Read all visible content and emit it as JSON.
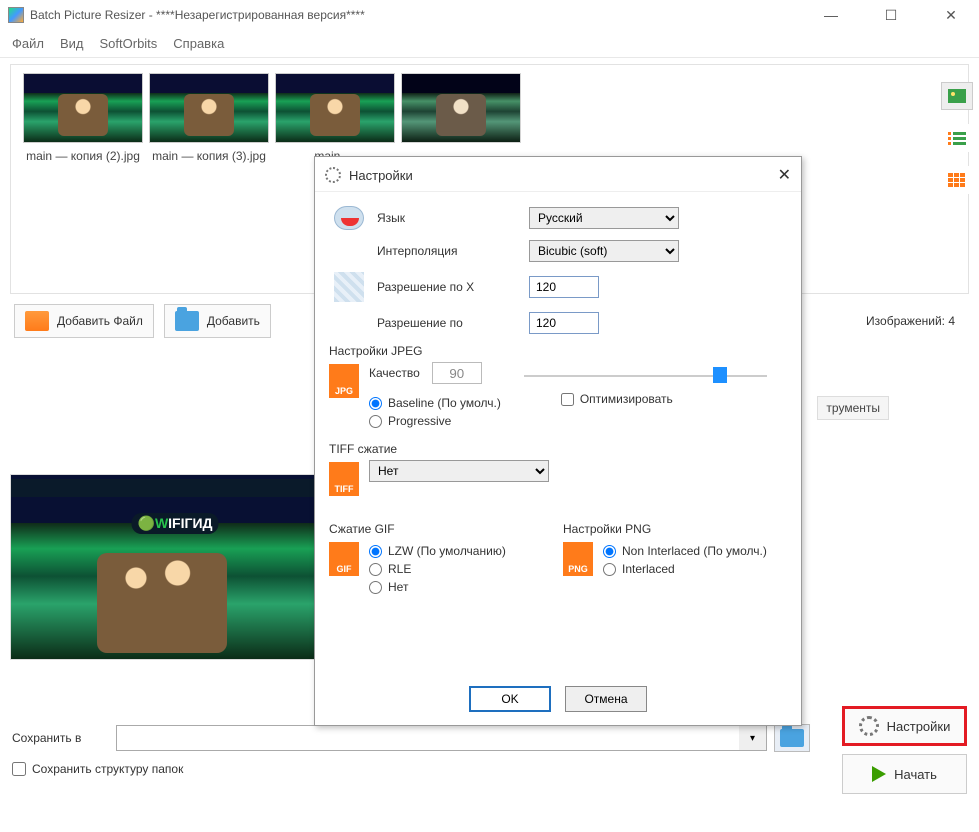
{
  "window": {
    "title": "Batch Picture Resizer - ****Незарегистрированная версия****"
  },
  "menu": {
    "file": "Файл",
    "view": "Вид",
    "softorbits": "SoftOrbits",
    "help": "Справка"
  },
  "thumbs": [
    {
      "name": "main — копия (2).jpg"
    },
    {
      "name": "main — копия (3).jpg"
    },
    {
      "name": "main —"
    },
    {
      "name": ""
    }
  ],
  "actions": {
    "add_file": "Добавить Файл",
    "add_folder": "Добавить"
  },
  "count_label": "Изображений: 4",
  "tab_tools": "трументы",
  "preview_logo": "WIFIГИД",
  "save": {
    "label": "Сохранить в",
    "structure": "Сохранить структуру папок"
  },
  "right_buttons": {
    "settings": "Настройки",
    "start": "Начать"
  },
  "dialog": {
    "title": "Настройки",
    "lang_label": "Язык",
    "lang_value": "Русский",
    "interp_label": "Интерполяция",
    "interp_value": "Bicubic (soft)",
    "resx_label": "Разрешение по X",
    "resx_value": "120",
    "resy_label": "Разрешение по",
    "resy_value": "120",
    "jpeg_group": "Настройки JPEG",
    "quality_label": "Качество",
    "quality_value": "90",
    "baseline": "Baseline (По умолч.)",
    "progressive": "Progressive",
    "optimize": "Оптимизировать",
    "tiff_group": "TIFF сжатие",
    "tiff_value": "Нет",
    "gif_group": "Сжатие GIF",
    "gif_lzw": "LZW (По умолчанию)",
    "gif_rle": "RLE",
    "gif_none": "Нет",
    "png_group": "Настройки PNG",
    "png_noninter": "Non Interlaced (По умолч.)",
    "png_inter": "Interlaced",
    "ok": "OK",
    "cancel": "Отмена",
    "icon": {
      "jpg": "JPG",
      "tiff": "TIFF",
      "gif": "GIF",
      "png": "PNG"
    }
  }
}
